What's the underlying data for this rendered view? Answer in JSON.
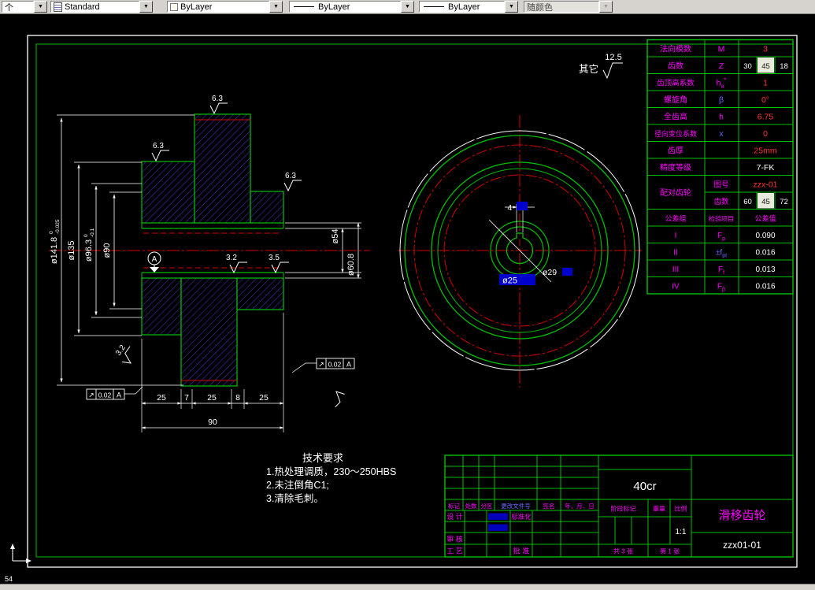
{
  "toolbar": {
    "combo1": "个",
    "style": "Standard",
    "color": "ByLayer",
    "linetype": "ByLayer",
    "lineweight": "ByLayer",
    "plotstyle": "随颜色"
  },
  "status": {
    "corner_text": "54"
  },
  "notes": {
    "other_label": "其它",
    "other_value": "12.5",
    "tech_title": "技术要求",
    "tech_1": "1.热处理调质，230～250HBS",
    "tech_2": "2.未注倒角C1;",
    "tech_3": "3.清除毛刺。"
  },
  "section": {
    "d141": "ø141.8",
    "d141_tol_top": "0",
    "d141_tol_bot": "-0.025",
    "d135": "ø135",
    "d96": "ø96.3",
    "d96_tol_top": "0",
    "d96_tol_bot": "-0.1",
    "d90": "ø90",
    "d54": "ø54",
    "d60": "ø60.8",
    "seg_a": "25",
    "seg_b": "7",
    "seg_c": "25",
    "seg_d": "8",
    "seg_e": "25",
    "total_len": "90",
    "r63": "6.3",
    "r63b": "6.3",
    "r63c": "6.3",
    "r32": "3.2",
    "r35": "3.5",
    "r32b": "3.2",
    "gdt_sym": "↗",
    "gdt_val": "0.02",
    "gdt_datum": "A",
    "datum": "A"
  },
  "front": {
    "keyway_w": "4",
    "bore": "ø25",
    "keyway_d": "ø29"
  },
  "param_table": {
    "r0": {
      "label": "法向模数",
      "sym": "M",
      "val": "3"
    },
    "r1": {
      "label": "齿数",
      "sym": "Z",
      "v1": "30",
      "v2": "45",
      "v3": "18"
    },
    "r2": {
      "label": "齿顶高系数",
      "sym": "h",
      "sub": "a",
      "sup": "*",
      "val": "1"
    },
    "r3": {
      "label": "螺旋角",
      "sym": "β",
      "val": "0°"
    },
    "r4": {
      "label": "全齿高",
      "sym": "h",
      "val": "6.75"
    },
    "r5": {
      "label": "径向变位系数",
      "sym": "x",
      "val": "0"
    },
    "r6": {
      "label": "齿厚",
      "val": "25mm"
    },
    "r7": {
      "label": "精度等级",
      "val": "7-FK"
    },
    "r8": {
      "label": "配对齿轮",
      "sub1": "图号",
      "val1": "zzx-01",
      "sub2": "齿数",
      "v1": "60",
      "v2": "45",
      "v3": "72"
    },
    "r10": {
      "c1": "公差组",
      "c2": "检验项目",
      "c3": "公差值"
    },
    "r11": {
      "g": "I",
      "sym": "F",
      "sub": "p",
      "val": "0.090"
    },
    "r12": {
      "g": "II",
      "sym": "±f",
      "sub": "pt",
      "val": "0.016"
    },
    "r13": {
      "g": "III",
      "sym": "F",
      "sub": "f",
      "val": "0.013"
    },
    "r14": {
      "g": "IV",
      "sym": "F",
      "sub": "β",
      "val": "0.016"
    }
  },
  "title_block": {
    "rev": [
      "标记",
      "处数",
      "分区",
      "更改文件号",
      "签名",
      "年、月、日"
    ],
    "design": "设 计",
    "standardize": "标准化",
    "check": "审 核",
    "craft": "工 艺",
    "approve": "批 准",
    "material": "40cr",
    "stage": "阶段标记",
    "weight": "重量",
    "scale": "比例",
    "scale_val": "1:1",
    "sheets": "共 3 张",
    "sheet_no": "第 1 张",
    "part_name": "滑移齿轮",
    "drawing_no": "zzx01-01"
  }
}
